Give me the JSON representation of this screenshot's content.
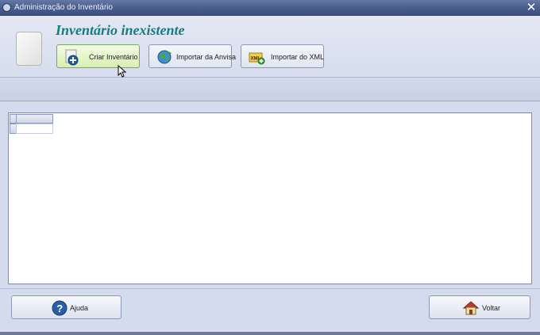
{
  "window": {
    "title": "Administração do Inventário",
    "close_glyph": "✕"
  },
  "header": {
    "title": "Inventário inexistente",
    "doc_icon": "document-icon",
    "buttons": [
      {
        "label": "Criar Inventário",
        "icon": "add-document-icon",
        "state": "hovered"
      },
      {
        "label": "Importar da Anvisa",
        "icon": "globe-icon"
      },
      {
        "label": "Importar do XML",
        "icon": "xml-import-icon"
      }
    ]
  },
  "grid": {
    "columns": [
      ""
    ],
    "rows": [
      [
        ""
      ]
    ]
  },
  "footer": {
    "help_label": "Ajuda",
    "back_label": "Voltar"
  },
  "colors": {
    "title_accent": "#177c7a",
    "background": "#d4dbec",
    "titlebar": "#4c5f8e"
  }
}
